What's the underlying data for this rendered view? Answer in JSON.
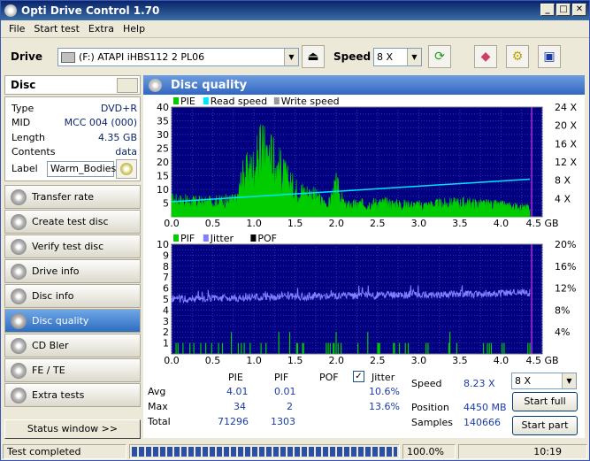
{
  "window": {
    "title": "Opti Drive Control 1.70",
    "min": "_",
    "max": "□",
    "close": "✕"
  },
  "menu": [
    "File",
    "Start test",
    "Extra",
    "Help"
  ],
  "toolbar": {
    "drive_label": "Drive",
    "drive_value": "(F:)  ATAPI iHBS112  2 PL06",
    "speed_label": "Speed",
    "speed_value": "8 X"
  },
  "disc": {
    "header": "Disc",
    "rows": [
      {
        "k": "Type",
        "v": "DVD+R"
      },
      {
        "k": "MID",
        "v": "MCC 004 (000)"
      },
      {
        "k": "Length",
        "v": "4.35 GB"
      },
      {
        "k": "Contents",
        "v": "data"
      }
    ],
    "label_key": "Label",
    "label_value": "Warm_Bodies"
  },
  "nav": [
    {
      "label": "Transfer rate",
      "active": false
    },
    {
      "label": "Create test disc",
      "active": false
    },
    {
      "label": "Verify test disc",
      "active": false
    },
    {
      "label": "Drive info",
      "active": false
    },
    {
      "label": "Disc info",
      "active": false
    },
    {
      "label": "Disc quality",
      "active": true
    },
    {
      "label": "CD Bler",
      "active": false
    },
    {
      "label": "FE / TE",
      "active": false
    },
    {
      "label": "Extra tests",
      "active": false
    }
  ],
  "status_window": "Status window >>",
  "panel_title": "Disc quality",
  "chart_data": [
    {
      "type": "area",
      "legend": [
        {
          "name": "PIE",
          "color": "#00cc00"
        },
        {
          "name": "Read speed",
          "color": "#00e5ff"
        },
        {
          "name": "Write speed",
          "color": "#999999"
        }
      ],
      "x_ticks": [
        "0.0",
        "0.5",
        "1.0",
        "1.5",
        "2.0",
        "2.5",
        "3.0",
        "3.5",
        "4.0",
        "4.5 GB"
      ],
      "xlim": [
        0,
        4.5
      ],
      "y_left_ticks": [
        "5",
        "10",
        "15",
        "20",
        "25",
        "30",
        "35",
        "40"
      ],
      "ylim_left": [
        0,
        40
      ],
      "y_right_ticks": [
        "4 X",
        "8 X",
        "12 X",
        "16 X",
        "20 X",
        "24 X"
      ],
      "ylim_right": [
        0,
        24
      ],
      "pie_profile": [
        [
          0.0,
          6
        ],
        [
          0.4,
          5
        ],
        [
          0.8,
          6
        ],
        [
          0.85,
          14
        ],
        [
          1.0,
          18
        ],
        [
          1.1,
          24
        ],
        [
          1.2,
          22
        ],
        [
          1.3,
          18
        ],
        [
          1.4,
          13
        ],
        [
          1.5,
          10
        ],
        [
          1.7,
          8
        ],
        [
          1.9,
          4
        ],
        [
          2.0,
          11
        ],
        [
          2.1,
          4
        ],
        [
          2.5,
          5
        ],
        [
          3.0,
          4
        ],
        [
          3.5,
          5
        ],
        [
          4.0,
          4
        ],
        [
          4.35,
          3
        ]
      ],
      "pie_max": 34,
      "read_speed": [
        [
          0.0,
          3.3
        ],
        [
          4.35,
          8.23
        ]
      ],
      "end_marker": 4.35
    },
    {
      "type": "area",
      "legend": [
        {
          "name": "PIF",
          "color": "#00cc00"
        },
        {
          "name": "Jitter",
          "color": "#8080ff"
        },
        {
          "name": "POF",
          "color": "#000000"
        }
      ],
      "x_ticks": [
        "0.0",
        "0.5",
        "1.0",
        "1.5",
        "2.0",
        "2.5",
        "3.0",
        "3.5",
        "4.0",
        "4.5 GB"
      ],
      "xlim": [
        0,
        4.5
      ],
      "y_left_ticks": [
        "1",
        "2",
        "3",
        "4",
        "5",
        "6",
        "7",
        "8",
        "9",
        "10"
      ],
      "ylim_left": [
        0,
        10
      ],
      "y_right_ticks": [
        "4%",
        "8%",
        "12%",
        "16%",
        "20%"
      ],
      "ylim_right": [
        0,
        20
      ],
      "jitter_profile": [
        [
          0.0,
          10.0
        ],
        [
          1.0,
          10.3
        ],
        [
          2.0,
          10.6
        ],
        [
          3.0,
          10.8
        ],
        [
          4.0,
          11.0
        ],
        [
          4.35,
          11.2
        ]
      ],
      "pif_max": 2,
      "end_marker": 4.35
    }
  ],
  "stats": {
    "headers": [
      "PIE",
      "PIF",
      "POF",
      "Jitter"
    ],
    "rows": [
      {
        "label": "Avg",
        "pie": "4.01",
        "pif": "0.01",
        "pof": "",
        "jitter": "10.6%"
      },
      {
        "label": "Max",
        "pie": "34",
        "pif": "2",
        "pof": "",
        "jitter": "13.6%"
      },
      {
        "label": "Total",
        "pie": "71296",
        "pif": "1303",
        "pof": "",
        "jitter": ""
      }
    ],
    "jitter_checked": true,
    "speed_label": "Speed",
    "speed_value": "8.23 X",
    "speed_select": "8 X",
    "position_label": "Position",
    "position_value": "4450 MB",
    "samples_label": "Samples",
    "samples_value": "140666",
    "start_full": "Start full",
    "start_part": "Start part"
  },
  "status": {
    "text": "Test completed",
    "progress": 100.0,
    "percent": "100.0%",
    "time": "10:19"
  }
}
